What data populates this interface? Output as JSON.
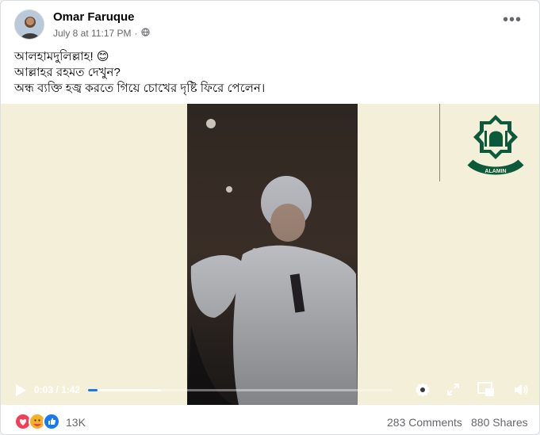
{
  "post": {
    "author": "Omar Faruque",
    "timestamp": "July 8 at 11:17 PM",
    "privacy_separator": "·",
    "privacy_icon": "globe-icon",
    "more_icon": "more-options-icon",
    "lines": [
      "আলহামদুলিল্লাহ! 😊",
      "আল্লাহর রহমত দেখুন?",
      "অন্ধ ব্যক্তি হজ্ব করতে গিয়ে চোখের দৃষ্টি ফিরে পেলেন।"
    ]
  },
  "video": {
    "watermark_text": "ALAMIN",
    "current_time": "0:03",
    "separator": "/",
    "duration": "1:42",
    "played_fraction": 0.03,
    "buffered_fraction": 0.24,
    "icons": [
      "play-icon",
      "settings-icon",
      "fullscreen-icon",
      "picture-in-picture-icon",
      "volume-icon"
    ]
  },
  "footer": {
    "reactions": [
      "love-icon",
      "care-icon",
      "like-icon"
    ],
    "reaction_count": "13K",
    "comments": "283 Comments",
    "shares": "880 Shares"
  },
  "colors": {
    "accent": "#1877f2",
    "text": "#050505",
    "secondary": "#65676b"
  }
}
